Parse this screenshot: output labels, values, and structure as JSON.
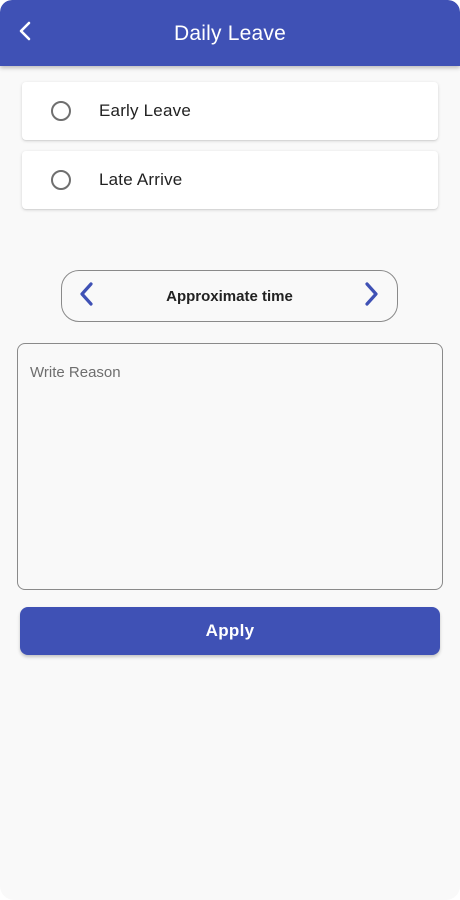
{
  "theme": {
    "primary": "#3f51b5",
    "background": "#f9f9f9",
    "card": "#ffffff",
    "text": "#222222",
    "border": "#8a8a8a"
  },
  "appbar": {
    "title": "Daily Leave",
    "back_icon": "chevron-left-icon"
  },
  "leave_options": [
    {
      "label": "Early Leave",
      "selected": false
    },
    {
      "label": "Late Arrive",
      "selected": false
    }
  ],
  "time_selector": {
    "label": "Approximate time",
    "prev_icon": "chevron-left-icon",
    "next_icon": "chevron-right-icon"
  },
  "reason": {
    "placeholder": "Write Reason",
    "value": ""
  },
  "apply_button": {
    "label": "Apply"
  }
}
